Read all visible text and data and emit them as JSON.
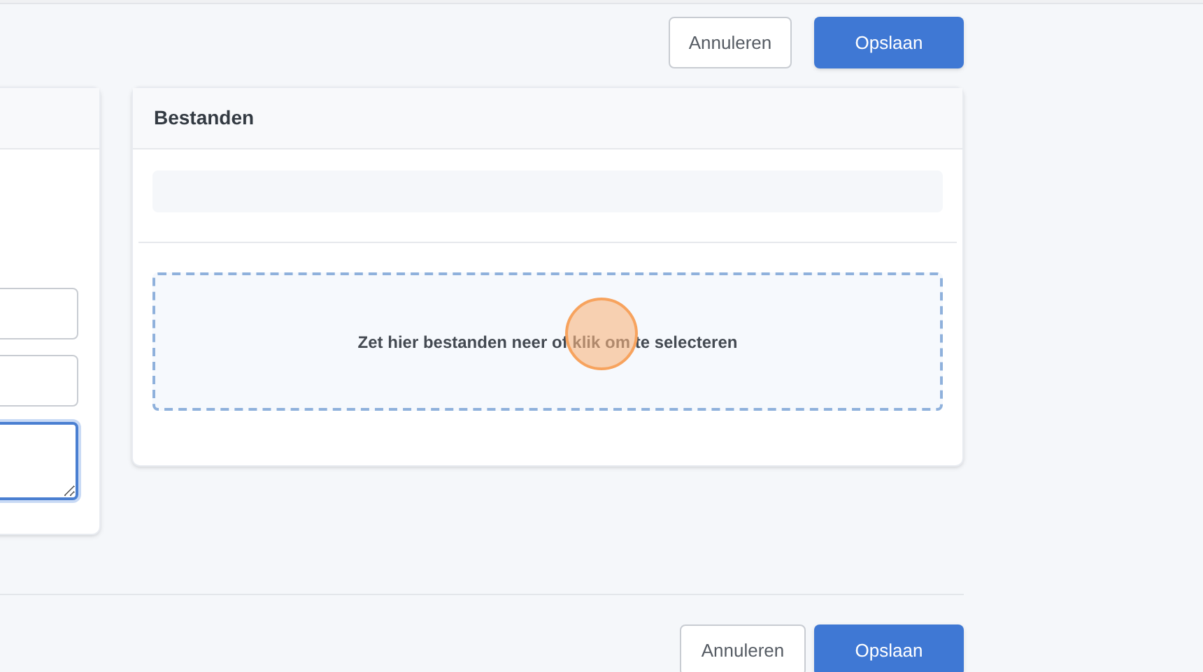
{
  "top_actions": [
    {
      "label": "Annuleren",
      "kind": "secondary"
    },
    {
      "label": "Opslaan",
      "kind": "primary"
    }
  ],
  "form_panel": {
    "fields": [
      {
        "kind": "input",
        "focused": false
      },
      {
        "kind": "input",
        "focused": false
      },
      {
        "kind": "textarea",
        "focused": true
      }
    ]
  },
  "files_panel": {
    "title": "Bestanden",
    "dropzone": {
      "text": "Zet hier bestanden neer of klik om te selecteren"
    }
  },
  "bottom_actions": [
    {
      "label": "Annuleren",
      "kind": "secondary"
    },
    {
      "label": "Opslaan",
      "kind": "primary"
    }
  ]
}
